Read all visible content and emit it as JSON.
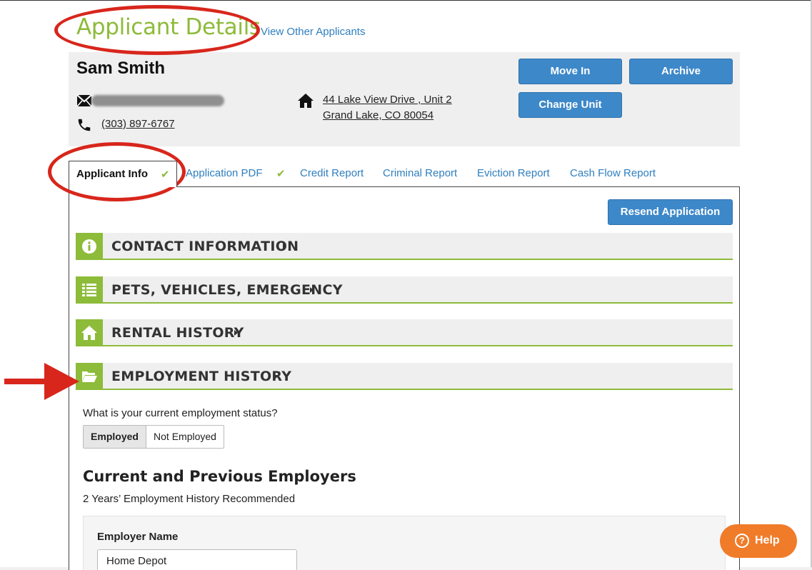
{
  "page": {
    "title": "Applicant Details",
    "view_other_link": "View Other Applicants"
  },
  "applicant": {
    "name": "Sam Smith",
    "email": "",
    "phone": "(303) 897-6767",
    "address_line1": "44 Lake View Drive , Unit 2",
    "address_line2": "Grand Lake, CO 80054"
  },
  "actions": {
    "move_in": "Move In",
    "archive": "Archive",
    "change_unit": "Change Unit",
    "resend": "Resend Application"
  },
  "tabs": [
    {
      "label": "Applicant Info",
      "active": true,
      "checked": true
    },
    {
      "label": "Application PDF",
      "active": false,
      "checked": true
    },
    {
      "label": "Credit Report",
      "active": false,
      "checked": false
    },
    {
      "label": "Criminal Report",
      "active": false,
      "checked": false
    },
    {
      "label": "Eviction Report",
      "active": false,
      "checked": false
    },
    {
      "label": "Cash Flow Report",
      "active": false,
      "checked": false
    }
  ],
  "sections": [
    {
      "label": "CONTACT INFORMATION",
      "icon": "info-icon",
      "expanded": false
    },
    {
      "label": "PETS, VEHICLES, EMERGENCY",
      "icon": "list-icon",
      "expanded": false
    },
    {
      "label": "RENTAL HISTORY",
      "icon": "home-icon",
      "expanded": false
    },
    {
      "label": "EMPLOYMENT HISTORY",
      "icon": "folder-open-icon",
      "expanded": true
    }
  ],
  "employment": {
    "question": "What is your current employment status?",
    "options": [
      "Employed",
      "Not Employed"
    ],
    "selected": "Employed",
    "heading": "Current and Previous Employers",
    "subheading": "2 Years’ Employment History Recommended",
    "employer_label": "Employer Name",
    "employer_value": "Home Depot"
  },
  "help": {
    "label": "Help",
    "icon_glyph": "?"
  },
  "colors": {
    "accent_green": "#8dbb3a",
    "button_blue": "#3d88c9",
    "link_blue": "#2f7fbf",
    "help_orange": "#f07c2a",
    "annotation_red": "#d8261c"
  }
}
